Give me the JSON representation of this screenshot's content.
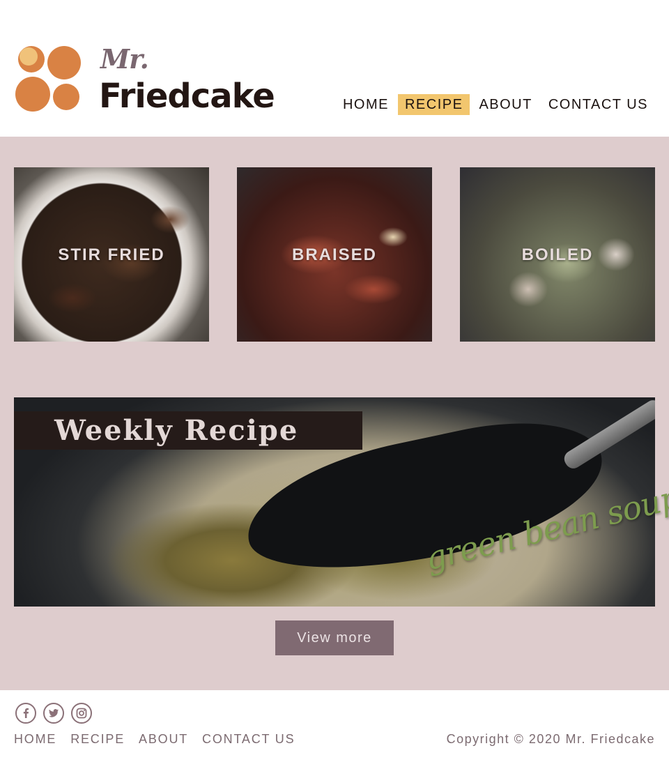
{
  "brand": {
    "mr": "Mr.",
    "name": "Friedcake",
    "logo_color": "#d98244"
  },
  "nav": {
    "items": [
      {
        "label": "HOME",
        "active": false
      },
      {
        "label": "RECIPE",
        "active": true
      },
      {
        "label": "ABOUT",
        "active": false
      },
      {
        "label": "CONTACT US",
        "active": false
      }
    ],
    "active_color": "#f2c66e"
  },
  "categories": [
    {
      "label": "STIR FRIED"
    },
    {
      "label": "BRAISED"
    },
    {
      "label": "BOILED"
    }
  ],
  "weekly": {
    "title": "Weekly Recipe",
    "dish": "green bean soup",
    "button_label": "View more"
  },
  "footer": {
    "socials": [
      "facebook-icon",
      "twitter-icon",
      "instagram-icon"
    ],
    "nav": [
      "HOME",
      "RECIPE",
      "ABOUT",
      "CONTACT US"
    ],
    "copyright": "Copyright © 2020 Mr. Friedcake"
  },
  "colors": {
    "background_main": "#decccd",
    "button": "#806a72",
    "dark_band": "#251b19"
  }
}
